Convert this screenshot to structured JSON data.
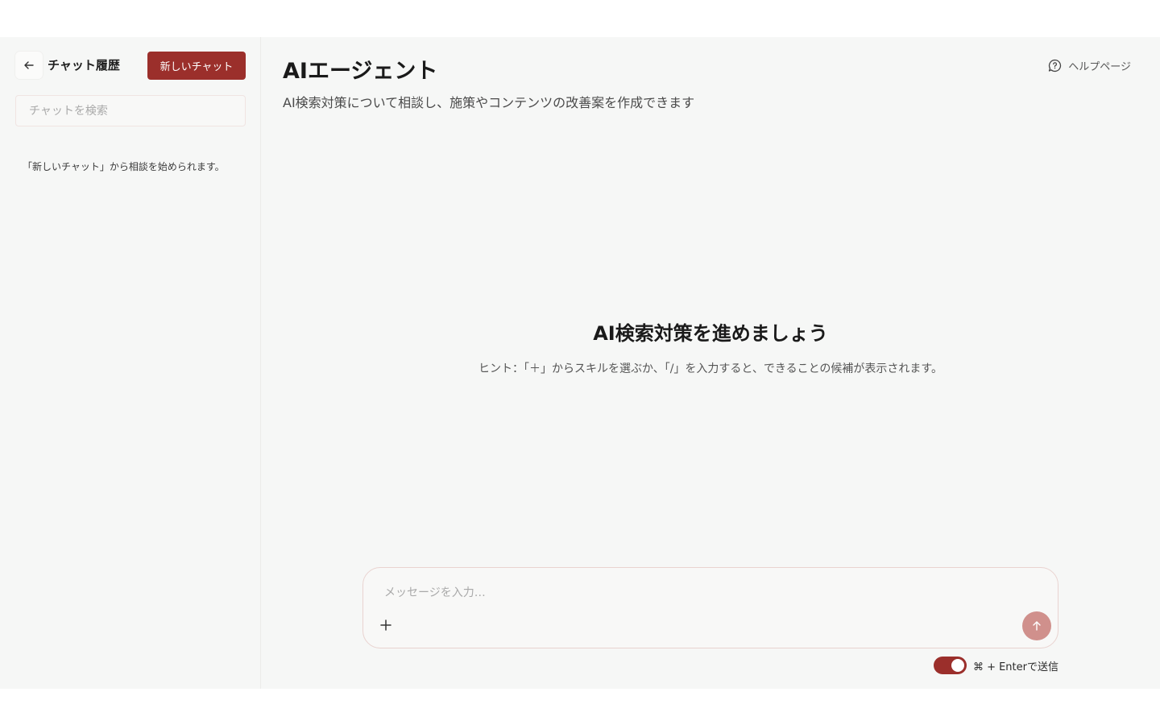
{
  "sidebar": {
    "back_icon": "arrow-left-icon",
    "title": "チャット履歴",
    "new_chat_label": "新しいチャット",
    "search_placeholder": "チャットを検索",
    "search_value": "",
    "empty_hint": "「新しいチャット」から相談を始められます。"
  },
  "header": {
    "title": "AIエージェント",
    "subtitle": "AI検索対策について相談し、施策やコンテンツの改善案を作成できます",
    "help_icon": "help-chat-icon",
    "help_label": "ヘルプページ"
  },
  "main": {
    "heading": "AI検索対策を進めましょう",
    "hint": "ヒント：「＋」からスキルを選ぶか、「/」を入力すると、できることの候補が表示されます。"
  },
  "composer": {
    "placeholder": "メッセージを入力…",
    "value": "",
    "plus_icon": "plus-icon",
    "send_icon": "arrow-up-icon",
    "toggle_on": true,
    "shortcut_label": "⌘ + Enterで送信"
  },
  "colors": {
    "accent": "#9b2f2b",
    "send_button": "#d0908c",
    "background": "#f6f7f6"
  }
}
